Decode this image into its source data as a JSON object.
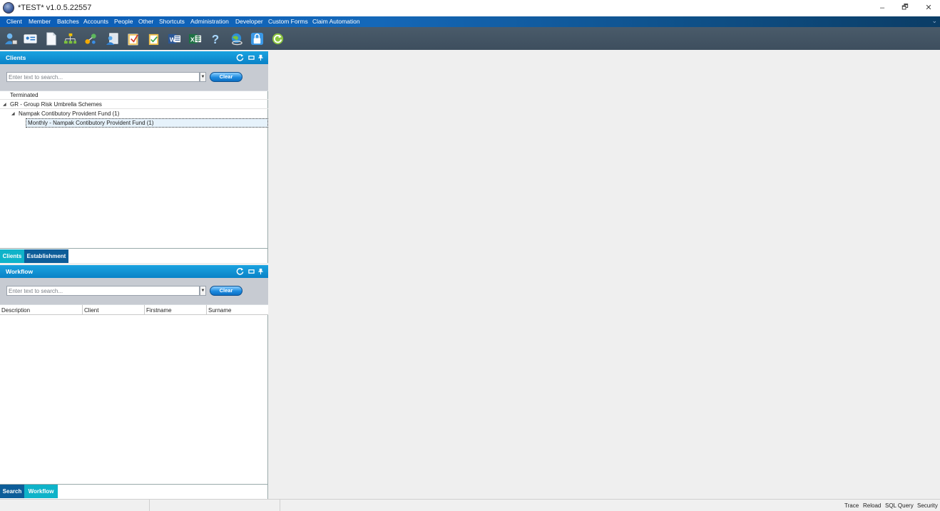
{
  "window": {
    "title": "*TEST* v1.0.5.22557",
    "minimize_symbol": "–",
    "restore_symbol": "🗗",
    "close_symbol": "✕"
  },
  "menu": {
    "items": [
      "Client",
      "Member",
      "Batches",
      "Accounts",
      "People",
      "Other",
      "Shortcuts",
      "Administration",
      "Developer",
      "Custom Forms",
      "Claim Automation"
    ],
    "chevron": "⌄"
  },
  "toolbar": {
    "icons": [
      "user-icon",
      "id-card-icon",
      "document-icon",
      "org-chart-icon",
      "workflow-icon",
      "user-export-icon",
      "clipboard-icon",
      "checklist-icon",
      "word-icon",
      "excel-icon",
      "help-icon",
      "globe-link-icon",
      "lock-icon",
      "refresh-icon"
    ],
    "word_glyph": "W",
    "excel_glyph": "X",
    "help_glyph": "?"
  },
  "clients_panel": {
    "title": "Clients",
    "search_placeholder": "Enter text to search...",
    "clear_label": "Clear",
    "tree": [
      {
        "label": "Terminated",
        "level": 0,
        "expanded": null
      },
      {
        "label": "GR - Group Risk Umbrella Schemes",
        "level": 0,
        "expanded": true
      },
      {
        "label": "Nampak Contibutory Provident Fund (1)",
        "level": 1,
        "expanded": true
      },
      {
        "label": "Monthly - Nampak Contibutory Provident Fund (1)",
        "level": 2,
        "expanded": null,
        "selected": true
      }
    ],
    "tabs": [
      "Clients",
      "Establishment"
    ]
  },
  "workflow_panel": {
    "title": "Workflow",
    "search_placeholder": "Enter text to search...",
    "clear_label": "Clear",
    "columns": [
      "Description",
      "Client",
      "Firstname",
      "Surname"
    ],
    "tabs": [
      "Search",
      "Workflow"
    ]
  },
  "statusbar": {
    "links": [
      "Trace",
      "Reload",
      "SQL Query",
      "Security"
    ]
  },
  "colors": {
    "menubar": "#1468b9",
    "toolbar": "#434f5e",
    "panel_header": "#0a82c7",
    "tab_active_teal": "#0fb3c9",
    "tab_dark_blue": "#0d5d99"
  }
}
